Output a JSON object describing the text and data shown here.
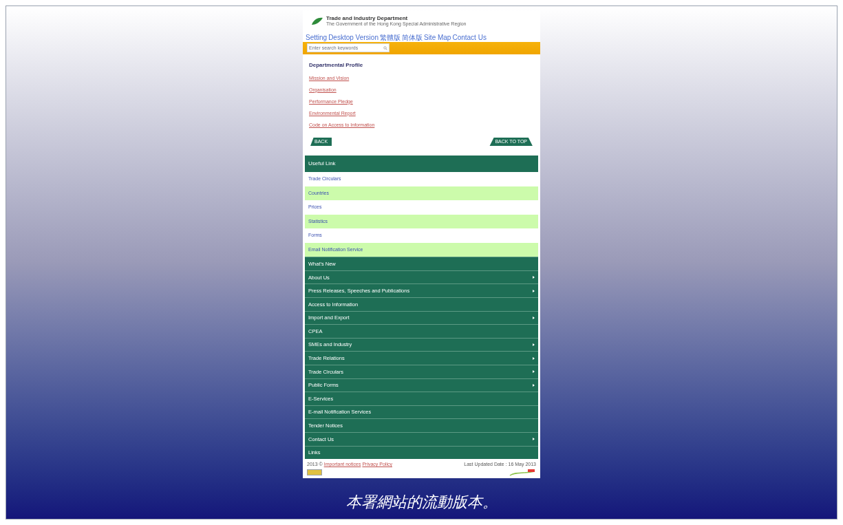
{
  "header": {
    "title": "Trade and Industry Department",
    "subtitle": "The Government of the Hong Kong Special Administrative Region"
  },
  "top_links": [
    "Setting",
    "Desktop Version",
    "繁體版",
    "简体版",
    "Site Map",
    "Contact Us"
  ],
  "search": {
    "placeholder": "Enter search keywords"
  },
  "profile": {
    "title": "Departmental Profile",
    "links": [
      "Mission and Vision",
      "Organisation",
      "Performance Pledge",
      "Environmental Report",
      "Code on Access to Information"
    ],
    "back": "BACK",
    "top": "BACK TO TOP"
  },
  "useful": {
    "title": "Useful Link",
    "items": [
      "Trade Circulars",
      "Countries",
      "Prices",
      "Statistics",
      "Forms",
      "Email Notification Service"
    ]
  },
  "menu": [
    {
      "label": "What's New",
      "expandable": false
    },
    {
      "label": "About Us",
      "expandable": true
    },
    {
      "label": "Press Releases, Speeches and Publications",
      "expandable": true
    },
    {
      "label": "Access to Information",
      "expandable": false
    },
    {
      "label": "Import and Export",
      "expandable": true
    },
    {
      "label": "CPEA",
      "expandable": false
    },
    {
      "label": "SMEs and Industry",
      "expandable": true
    },
    {
      "label": "Trade Relations",
      "expandable": true
    },
    {
      "label": "Trade Circulars",
      "expandable": true
    },
    {
      "label": "Public Forms",
      "expandable": true
    },
    {
      "label": "E-Services",
      "expandable": false
    },
    {
      "label": "E-mail Notification Services",
      "expandable": false
    },
    {
      "label": "Tender Notices",
      "expandable": false
    },
    {
      "label": "Contact Us",
      "expandable": true
    },
    {
      "label": "Links",
      "expandable": false
    }
  ],
  "footer": {
    "copyright": "2013 ©",
    "links": [
      "Important notices",
      "Privacy Policy"
    ],
    "updated": "Last Updated Date : 16 May 2013"
  },
  "caption": "本署網站的流動版本。"
}
